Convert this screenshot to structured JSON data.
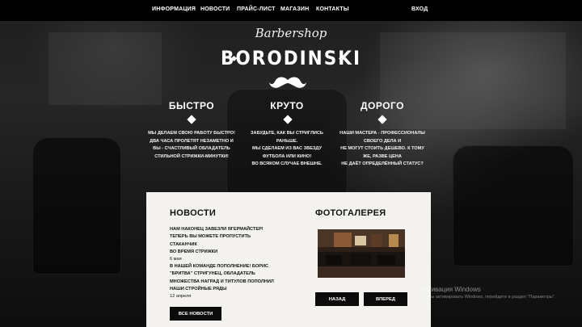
{
  "nav": {
    "items": [
      {
        "label": "ИНФОРМАЦИЯ"
      },
      {
        "label": "НОВОСТИ"
      },
      {
        "label": "ПРАЙС-ЛИСТ"
      },
      {
        "label": "МАГАЗИН"
      },
      {
        "label": "КОНТАКТЫ"
      }
    ],
    "login": "ВХОД"
  },
  "logo": {
    "script": "Barbershop",
    "name": "BORODINSKI"
  },
  "features": [
    {
      "title": "БЫСТРО",
      "lines": [
        "МЫ ДЕЛАЕМ СВОЮ РАБОТУ БЫСТРО!",
        "ДВА ЧАСА ПРОЛЕТЯТ НЕЗАМЕТНО И",
        "ВЫ - СЧАСТЛИВЫЙ ОБЛАДАТЕЛЬ",
        "СТИЛЬНОЙ СТРИЖКИ-МИНУТКИ!"
      ]
    },
    {
      "title": "КРУТО",
      "lines": [
        "ЗАБУДЬТЕ, КАК ВЫ СТРИГЛИСЬ",
        "РАНЬШЕ.",
        "МЫ СДЕЛАЕМ ИЗ ВАС ЗВЕЗДУ",
        "ФУТБОЛА ИЛИ КИНО!",
        "ВО ВСЯКОМ СЛУЧАЕ ВНЕШНЕ."
      ]
    },
    {
      "title": "ДОРОГО",
      "lines": [
        "НАШИ МАСТЕРА - ПРОФЕССИОНАЛЫ",
        "СВОЕГО ДЕЛА И",
        "НЕ МОГУТ СТОИТЬ ДЕШЕВО. К ТОМУ",
        "ЖЕ, РАЗВЕ ЦЕНА",
        "НЕ ДАЁТ ОПРЕДЕЛЁННЫЙ СТАТУС?"
      ]
    }
  ],
  "news": {
    "title": "НОВОСТИ",
    "items": [
      {
        "lines": [
          "НАМ НАКОНЕЦ ЗАВЕЗЛИ ЯГЕРМАЙСТЕР!",
          "ТЕПЕРЬ ВЫ МОЖЕТЕ ПРОПУСТИТЬ СТАКАНЧИК",
          "ВО ВРЕМЯ СТРИЖКИ"
        ],
        "date": "6 мая"
      },
      {
        "lines": [
          "В НАШЕЙ КОМАНДЕ ПОПОЛНЕНИЕ! БОРИС",
          "\"БРИТВА\" СТРИГУНЕЦ, ОБЛАДАТЕЛЬ",
          "МНОЖЕСТВА НАГРАД И ТИТУЛОВ ПОПОЛНИЛ",
          "НАШИ СТРОЙНЫЕ РЯДЫ"
        ],
        "date": "12 апреля"
      }
    ],
    "all_button": "ВСЕ НОВОСТИ"
  },
  "gallery": {
    "title": "ФОТОГАЛЕРЕЯ",
    "prev_button": "НАЗАД",
    "next_button": "ВПЕРЕД"
  },
  "watermark": {
    "title": "Активация Windows",
    "subtitle": "Чтобы активировать Windows, перейдите в раздел \"Параметры\"."
  },
  "colors": {
    "nav_bg": "#000000",
    "panel_bg": "#f3f2ef",
    "button_bg": "#0b0b0b"
  }
}
